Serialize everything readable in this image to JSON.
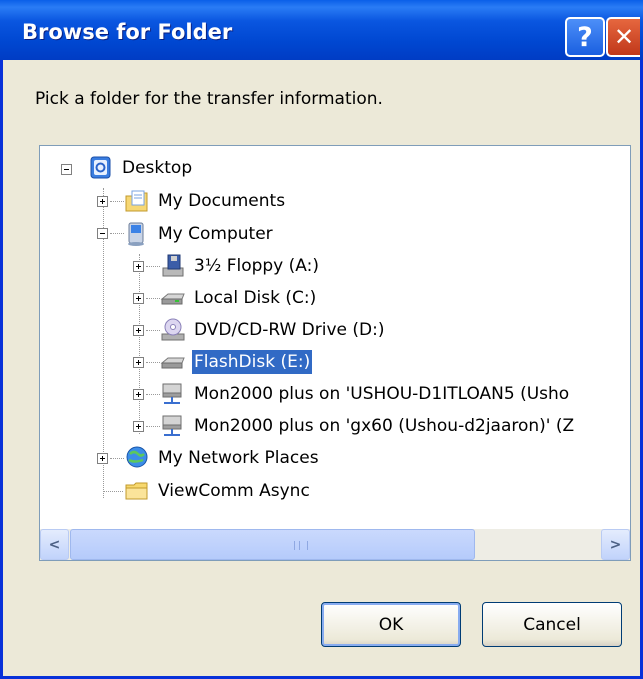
{
  "window": {
    "title": "Browse for Folder",
    "help_glyph": "?",
    "close_glyph": "✕"
  },
  "prompt": "Pick a folder for the transfer information.",
  "tree": {
    "items": [
      {
        "label": "Desktop",
        "icon": "desktop-icon",
        "expander": "minus"
      },
      {
        "label": "My Documents",
        "icon": "documents-folder-icon",
        "expander": "plus"
      },
      {
        "label": "My Computer",
        "icon": "computer-icon",
        "expander": "minus"
      },
      {
        "label": "3½ Floppy (A:)",
        "icon": "floppy-drive-icon",
        "expander": "plus"
      },
      {
        "label": "Local Disk (C:)",
        "icon": "hard-disk-icon",
        "expander": "plus"
      },
      {
        "label": "DVD/CD-RW Drive (D:)",
        "icon": "cd-drive-icon",
        "expander": "plus"
      },
      {
        "label": "FlashDisk (E:)",
        "icon": "removable-disk-icon",
        "expander": "plus",
        "selected": true
      },
      {
        "label": "Mon2000 plus on 'USHOU-D1ITLOAN5 (Usho",
        "icon": "network-share-icon",
        "expander": "plus"
      },
      {
        "label": "Mon2000 plus on 'gx60 (Ushou-d2jaaron)' (Z",
        "icon": "network-share-icon",
        "expander": "plus"
      },
      {
        "label": "My Network Places",
        "icon": "network-places-icon",
        "expander": "plus"
      },
      {
        "label": "ViewComm Async",
        "icon": "folder-icon",
        "expander": "none"
      }
    ]
  },
  "scrollbar": {
    "left_arrow": "<",
    "right_arrow": ">"
  },
  "buttons": {
    "ok": "OK",
    "cancel": "Cancel"
  }
}
